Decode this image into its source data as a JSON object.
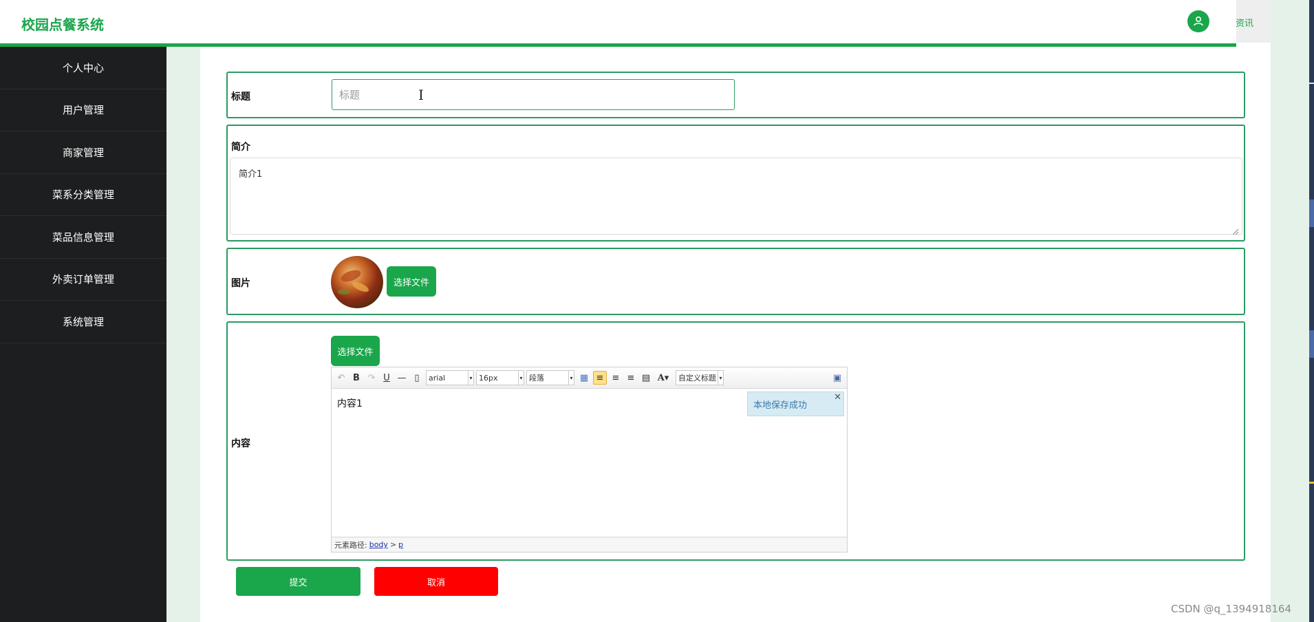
{
  "header": {
    "brand": "校园点餐系统",
    "right_text": "资讯"
  },
  "sidebar": {
    "items": [
      {
        "label": "个人中心"
      },
      {
        "label": "用户管理"
      },
      {
        "label": "商家管理"
      },
      {
        "label": "菜系分类管理"
      },
      {
        "label": "菜品信息管理"
      },
      {
        "label": "外卖订单管理"
      },
      {
        "label": "系统管理"
      }
    ]
  },
  "form": {
    "title": {
      "label": "标题",
      "placeholder": "标题",
      "value": ""
    },
    "intro": {
      "label": "简介",
      "value": "简介1"
    },
    "image": {
      "label": "图片",
      "button": "选择文件"
    },
    "content": {
      "label": "内容",
      "button": "选择文件",
      "toolbar": {
        "font": "arial",
        "size": "16px",
        "paragraph": "段落",
        "custom_title": "自定义标题"
      },
      "body": "内容1",
      "toast": "本地保存成功",
      "path": {
        "prefix": "元素路径:",
        "body": "body",
        "sep": ">",
        "p": "p"
      }
    },
    "submit": "提交",
    "cancel": "取消"
  },
  "watermark": "CSDN @q_1394918164",
  "colors": {
    "accent": "#1aa64a",
    "danger": "#ff0000",
    "sidebar": "#1d1e1f"
  }
}
